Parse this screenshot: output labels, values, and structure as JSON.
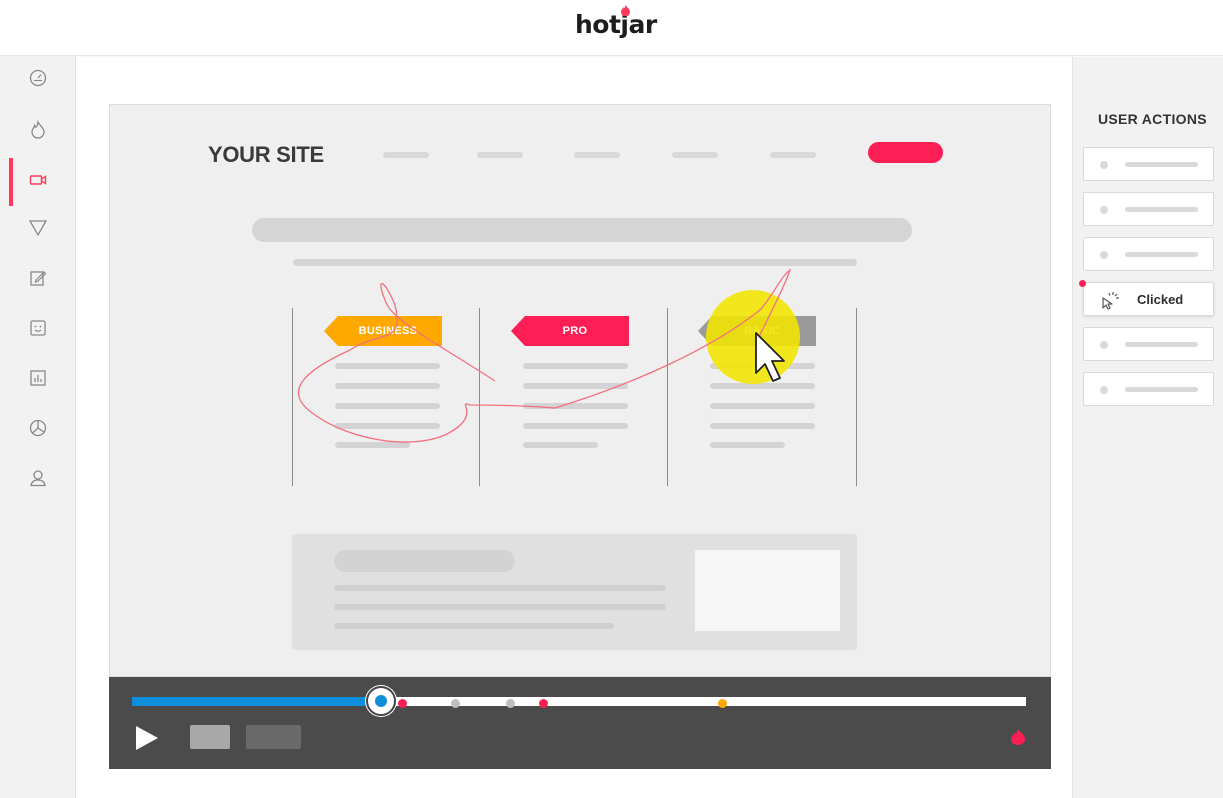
{
  "header": {
    "logo_text": "hotjar"
  },
  "sidebar": {
    "items": [
      {
        "name": "dashboard",
        "icon": "gauge-icon"
      },
      {
        "name": "heatmaps",
        "icon": "flame-icon"
      },
      {
        "name": "recordings",
        "icon": "video-camera-icon",
        "active": true
      },
      {
        "name": "funnels",
        "icon": "funnel-icon"
      },
      {
        "name": "forms",
        "icon": "edit-icon"
      },
      {
        "name": "feedback",
        "icon": "smiley-icon"
      },
      {
        "name": "polls",
        "icon": "bar-chart-icon"
      },
      {
        "name": "surveys",
        "icon": "pie-chart-icon"
      },
      {
        "name": "recruiters",
        "icon": "user-icon"
      }
    ]
  },
  "site": {
    "title": "YOUR SITE",
    "plans": [
      {
        "label": "BUSINESS",
        "color": "#ffa800"
      },
      {
        "label": "PRO",
        "color": "#fd1e55"
      },
      {
        "label": "BASIC",
        "color": "#9a9a9a"
      }
    ]
  },
  "player": {
    "progress_fraction": 0.28,
    "accent_color": "#0f8edb",
    "event_colors": [
      "#fd1e55",
      "#bfbfbf",
      "#bfbfbf",
      "#fd1e55",
      "#ffa800"
    ]
  },
  "actions_panel": {
    "title": "USER ACTIONS",
    "clicked_label": "Clicked"
  },
  "colors": {
    "brand_red": "#fd1e55",
    "highlight_yellow": "#f2e600"
  }
}
